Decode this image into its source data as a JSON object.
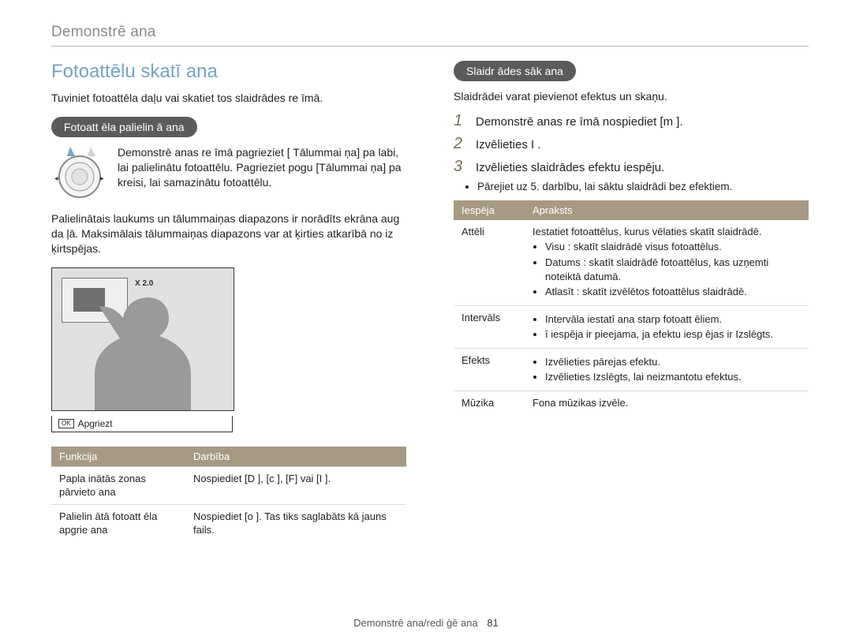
{
  "header": {
    "title": "Demonstrē ana"
  },
  "left": {
    "section_title": "Fotoattēlu skatī ana",
    "intro": "Tuviniet fotoattēla daļu vai skatiet tos slaidrādes re īmā.",
    "pill": "Fotoatt ēla palielin ā ana",
    "dial_text": "Demonstrē anas re īmā pagrieziet [ Tālummai ņa] pa labi, lai palielinātu fotoattēlu. Pagrieziet pogu [Tālummai ņa] pa kreisi, lai samazinātu fotoattēlu.",
    "paragraph": "Palielinātais laukums un tālummaiņas diapazons ir norādīts ekrāna aug da ļā. Maksimālais tālummaiņas diapazons var at ķirties atkarībā no iz ķirtspējas.",
    "preview": {
      "zoom": "X 2.0",
      "ok": "OK",
      "caption": "Apgriezt"
    },
    "table": {
      "head_function": "Funkcija",
      "head_action": "Darbība",
      "rows": [
        {
          "f": "Papla inātās zonas pārvieto ana",
          "a": "Nospiediet [D      ], [c   ], [F] vai [I      ]."
        },
        {
          "f": "Palielin ātā fotoatt ēla apgrie ana",
          "a": "Nospiediet [o   ]. Tas tiks saglabāts kā jauns fails."
        }
      ]
    }
  },
  "right": {
    "pill": "Slaidr ādes sāk ana",
    "intro": "Slaidrādei varat pievienot efektus un skaņu.",
    "steps": [
      "Demonstrē anas re   īmā nospiediet [m        ].",
      "Izvēlieties I     .",
      "Izvēlieties slaidrādes efektu iespēju."
    ],
    "sub_bullets": [
      "Pārejiet uz 5. darbību, lai sāktu slaidrādi bez efektiem."
    ],
    "table": {
      "head_option": "Iespēja",
      "head_desc": "Apraksts",
      "rows": [
        {
          "opt": "Attēli",
          "desc_lead": "Iestatiet fotoattēlus, kurus vēlaties skatīt slaidrādē.",
          "bullets": [
            "Visu : skatīt slaidrādē visus fotoattēlus.",
            "Datums : skatīt slaidrādē fotoattēlus, kas uzņemti noteiktā datumā.",
            "Atlasīt : skatīt izvēlētos fotoattēlus slaidrādē."
          ]
        },
        {
          "opt": "Intervāls",
          "desc_lead": "",
          "bullets": [
            "Intervāla iestatī ana starp fotoatt ēliem.",
            "ī iespēja ir pieejama, ja efektu iesp ējas ir Izslēgts."
          ]
        },
        {
          "opt": "Efekts",
          "desc_lead": "",
          "bullets": [
            "Izvēlieties pārejas efektu.",
            "Izvēlieties Izslēgts, lai neizmantotu efektus."
          ]
        },
        {
          "opt": "Mūzika",
          "desc_lead": "Fona mūzikas izvēle.",
          "bullets": []
        }
      ]
    }
  },
  "footer": {
    "text": "Demonstrē ana/redi ģē ana",
    "page": "81"
  }
}
